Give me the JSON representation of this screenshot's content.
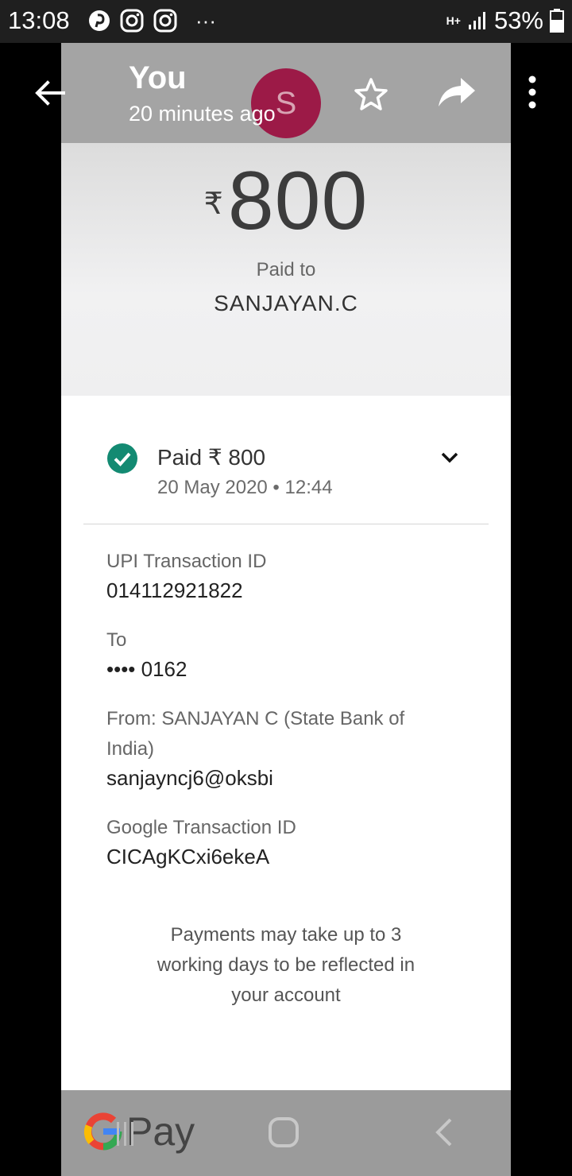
{
  "status_bar": {
    "time": "13:08",
    "battery": "53%",
    "more": "···",
    "network": "H+"
  },
  "header": {
    "title": "You",
    "subtitle": "20 minutes ago",
    "avatar_letter": "S"
  },
  "amount": {
    "currency": "₹",
    "value": "800"
  },
  "paid_to_label": "Paid to",
  "payee": "SANJAYAN.C",
  "status": {
    "text": "Paid ₹ 800",
    "date": "20 May 2020 • 12:44"
  },
  "details": [
    {
      "label": "UPI Transaction ID",
      "value": "014112921822"
    },
    {
      "label": "To",
      "value": "•••• 0162"
    },
    {
      "label": "From: SANJAYAN  C (State Bank of India)",
      "value": "sanjayncj6@oksbi"
    },
    {
      "label": "Google Transaction ID",
      "value": "CICAgKCxi6ekeA"
    }
  ],
  "note": "Payments may take up to 3 working days to be reflected in your account",
  "brand": {
    "pay": "Pay"
  },
  "colors": {
    "avatar": "#9c1a47",
    "check": "#138a72",
    "appbar": "#a4a4a4"
  },
  "icons": [
    "back-arrow-icon",
    "star-icon",
    "share-icon",
    "more-vert-icon",
    "check-circle-icon",
    "chevron-down-icon",
    "home-icon",
    "nav-back-icon",
    "recents-icon"
  ]
}
